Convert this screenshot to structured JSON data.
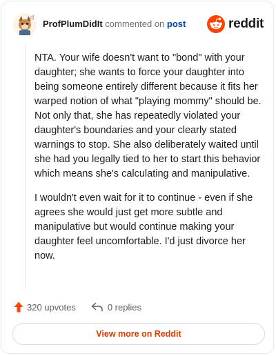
{
  "header": {
    "author": "ProfPlumDidIt",
    "action_text": "commented on",
    "post_link": "post",
    "brand_name": "reddit",
    "brand_color": "#ff4500"
  },
  "comment": {
    "paragraphs": [
      "NTA. Your wife doesn't want to \"bond\" with your daughter; she wants to force your daughter into being someone entirely different because it fits her warped notion of what \"playing mommy\" should be. Not only that, she has repeatedly violated your daughter's boundaries and your clearly stated warnings to stop. She also deliberately waited until she had you legally tied to her to start this behavior which means she's calculating and manipulative.",
      "I wouldn't even wait for it to continue - even if she agrees she would just get more subtle and manipulative but would continue making your daughter feel uncomfortable. I'd just divorce her now."
    ]
  },
  "actions": {
    "upvotes_label": "320 upvotes",
    "upvote_icon": "upvote-arrow-icon",
    "upvote_color": "#ff4500",
    "replies_label": "0 replies",
    "reply_icon": "reply-arrow-icon"
  },
  "footer": {
    "view_more_label": "View more on Reddit",
    "view_more_color": "#d93a00"
  }
}
